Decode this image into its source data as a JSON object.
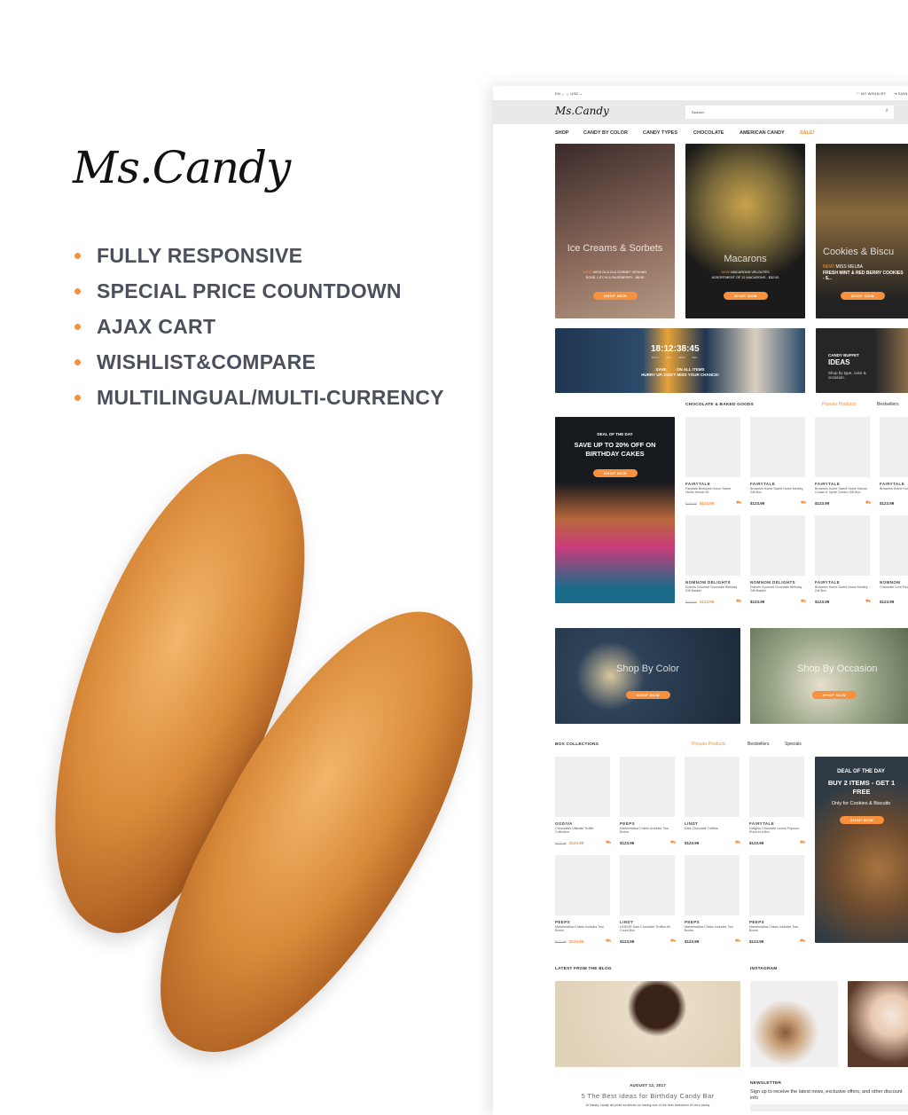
{
  "promo": {
    "logo": "Ms.Candy",
    "features": [
      "FULLY RESPONSIVE",
      "SPECIAL PRICE COUNTDOWN",
      "AJAX CART",
      "WISHLIST&COMPARE",
      "MULTILINGUAL/MULTI-CURRENCY"
    ],
    "accent": "#f7913d"
  },
  "site": {
    "topbar": {
      "language": "EN",
      "currency": "USD",
      "wishlist": "MY WISHLIST",
      "signin": "SIGN"
    },
    "logo": "Ms.Candy",
    "search_placeholder": "Search",
    "nav": [
      "SHOP",
      "CANDY BY COLOR",
      "CANDY TYPES",
      "CHOCOLATE",
      "AMERICAN CANDY",
      "SALE!"
    ],
    "categories": [
      {
        "title": "Ice Creams & Sorbets",
        "new": "NEW!",
        "line1": "MISS GLA GLA SORBET ISPAHAN",
        "line2": "ROSE, LITCHI & RASPBERRY - $6.90",
        "button": "SHOP NOW"
      },
      {
        "title": "Macarons",
        "new": "NEW!",
        "line1": "MACARONS VELOUTÉS",
        "line2": "ASSORTMENT OF 12 MACARONS - $32.00",
        "button": "SHOP NOW"
      },
      {
        "title": "Cookies & Biscu",
        "new": "NEW!",
        "line1": "MISS MELBA",
        "line2": "FRESH MINT & RED BERRY COOKIES - $...",
        "button": "SHOP NOW"
      }
    ],
    "countdown": {
      "days": "18",
      "hrs": "12",
      "mins": "38",
      "sec": "45",
      "l_days": "DAYS",
      "l_hrs": "HRS",
      "l_mins": "MINS",
      "l_sec": "SEC",
      "save_a": "SAVE",
      "save_pct": "50%",
      "save_b": "ON ALL ITEMS",
      "hurry": "HURRY UP, DON'T MISS YOUR CHANCE!"
    },
    "buffet": {
      "kicker": "CANDY BUFFET",
      "title": "IDEAS",
      "text": "Shop by type, color & occasion."
    },
    "section1": {
      "title": "CHOCOLATE & BAKED GOODS",
      "tabs": [
        "Popular Products",
        "Bestsellers"
      ]
    },
    "deal1": {
      "kicker": "DEAL OF THE DAY",
      "title": "SAVE UP TO 20% OFF ON BIRTHDAY CAKES",
      "button": "SHOP NOW"
    },
    "products1": [
      {
        "brand": "FAIRYTALE",
        "name": "Fairytale Brownies Home Sweet Home Morsel 36",
        "old": "$123.99",
        "price": "$123.99"
      },
      {
        "brand": "FAIRYTALE",
        "name": "Brownies Home Sweet Home Medley Gift Box",
        "old": "",
        "price": "$123.99"
      },
      {
        "brand": "FAIRYTALE",
        "name": "Brownies Home Sweet Home Deluxe Cookie & Sprite Combo Gift Box",
        "old": "",
        "price": "$123.99"
      },
      {
        "brand": "FAIRYTALE",
        "name": "Brownies Home Home Medley G",
        "old": "",
        "price": "$123.99"
      },
      {
        "brand": "NOMNOM DELIGHTS",
        "name": "Dulcets Gourmet Chocolate Birthday Gift Basket",
        "old": "$123.99",
        "price": "$123.99"
      },
      {
        "brand": "NOMNOM DELIGHTS",
        "name": "Dulcets Gourmet Chocolate Birthday Gift Basket",
        "old": "",
        "price": "$123.99"
      },
      {
        "brand": "FAIRYTALE",
        "name": "Brownies Home Sweet Home Medley Gift Box",
        "old": "",
        "price": "$123.99"
      },
      {
        "brand": "NOMNOM",
        "name": "Chocolate Love Pizza in a Box",
        "old": "",
        "price": "$123.99"
      }
    ],
    "shopby": [
      {
        "title": "Shop By Color",
        "button": "SHOP NOW"
      },
      {
        "title": "Shop By Occasion",
        "button": "SHOP NOW"
      }
    ],
    "section2": {
      "title": "BOX COLLECTIONS",
      "tabs": [
        "Popular Products",
        "Bestsellers",
        "Specials"
      ]
    },
    "products2": [
      {
        "brand": "GODIVA",
        "name": "Chocolatier Ultimate Truffle Collection",
        "old": "$123.99",
        "price": "$123.99"
      },
      {
        "brand": "PEEPS",
        "name": "Marshmallow Chicks Includes Two Boxes",
        "old": "",
        "price": "$123.99"
      },
      {
        "brand": "LINDT",
        "name": "Dark Chocolate Truffles",
        "old": "",
        "price": "$123.99"
      },
      {
        "brand": "FAIRYTALE",
        "name": "Delights Chocolate Lovers Popcorn Pizza in a Box",
        "old": "",
        "price": "$123.99"
      },
      {
        "brand": "PEEPS",
        "name": "Marshmallow Chicks Includes Two Boxes",
        "old": "$123.99",
        "price": "$123.99"
      },
      {
        "brand": "LINDT",
        "name": "LINDOR Dark Chocolate Truffles 60 Count Box",
        "old": "",
        "price": "$123.99"
      },
      {
        "brand": "PEEPS",
        "name": "Marshmallow Chicks Includes Two Boxes",
        "old": "",
        "price": "$123.99"
      },
      {
        "brand": "PEEPS",
        "name": "Marshmallow Chicks Includes Two Boxes",
        "old": "",
        "price": "$123.99"
      }
    ],
    "deal2": {
      "kicker": "DEAL OF THE DAY",
      "title": "BUY 2 ITEMS - GET 1 FREE",
      "text": "Only for Cookies & Biscuits",
      "button": "SHOP NOW"
    },
    "blog": {
      "title": "LATEST FROM THE BLOG",
      "date": "AUGUST 12, 2017",
      "post": "5 The Best Ideas for Birthday Candy Bar",
      "excerpt": "At Handy Candy we pride ourselves on having one of the best selections of retro candy"
    },
    "instagram": {
      "title": "INSTAGRAM"
    },
    "newsletter": {
      "title": "NEWSLETTER",
      "text": "Sign up to receive the latest news, exclusive offers, and other discount info"
    }
  }
}
